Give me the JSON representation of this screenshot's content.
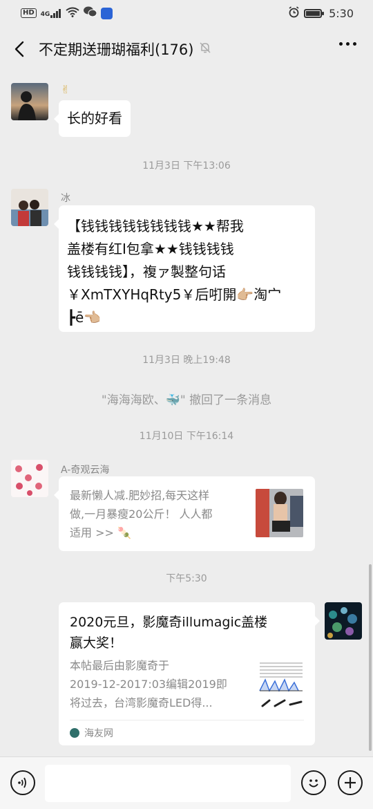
{
  "status_bar": {
    "hd": "HD",
    "signal": "4G",
    "time": "5:30",
    "battery_level": 0.9,
    "icons": [
      "hd-icon",
      "signal-icon",
      "wifi-icon",
      "wechat-notification-icon",
      "app-notification-icon",
      "alarm-icon",
      "battery-icon"
    ]
  },
  "header": {
    "title": "不定期送珊瑚福利(176)",
    "icons": [
      "back-icon",
      "mute-icon",
      "more-icon"
    ]
  },
  "messages": [
    {
      "type": "text",
      "side": "left",
      "avatar": "avatar-silhouette",
      "sender_emoji": "✌",
      "text": "长的好看"
    },
    {
      "type": "time",
      "text": "11月3日 下午13:06"
    },
    {
      "type": "text",
      "side": "left",
      "avatar": "avatar-couple",
      "sender": "冰",
      "lines": [
        "【钱钱钱钱钱钱钱钱★★帮我",
        "盖楼有红I包拿★★钱钱钱钱",
        "钱钱钱钱】，複ァ製整句话",
        "￥XmTXYHqRty5￥后咑開👉🏼淘宀",
        "┣ē👈🏼"
      ]
    },
    {
      "type": "time",
      "text": "11月3日 晚上19:48"
    },
    {
      "type": "system",
      "text": "\"海海海欧、🐳\" 撤回了一条消息"
    },
    {
      "type": "time",
      "text": "11月10日 下午16:14"
    },
    {
      "type": "link",
      "side": "left",
      "avatar": "avatar-pattern",
      "sender": "A-奇观云海",
      "lines": [
        "最新懒人减.肥妙招,每天这样",
        "做,一月暴瘦20公斤！ 人人都",
        "适用 >> 🍡"
      ]
    },
    {
      "type": "time",
      "text": "下午5:30"
    },
    {
      "type": "card",
      "side": "right",
      "avatar": "avatar-coral",
      "title_lines": [
        "2020元旦，影魔奇illumagic盖楼",
        "赢大奖！"
      ],
      "desc_lines": [
        "本帖最后由影魔奇于",
        "2019-12-2017:03编辑2019即",
        "将过去，台湾影魔奇LED得..."
      ],
      "source": "海友网"
    }
  ],
  "input_bar": {
    "placeholder": "",
    "icons": [
      "voice-icon",
      "emoji-icon",
      "plus-icon"
    ]
  },
  "colors": {
    "background": "#ededed",
    "bubble": "#ffffff",
    "timestamp": "#9a9a9a",
    "text": "#111111"
  }
}
